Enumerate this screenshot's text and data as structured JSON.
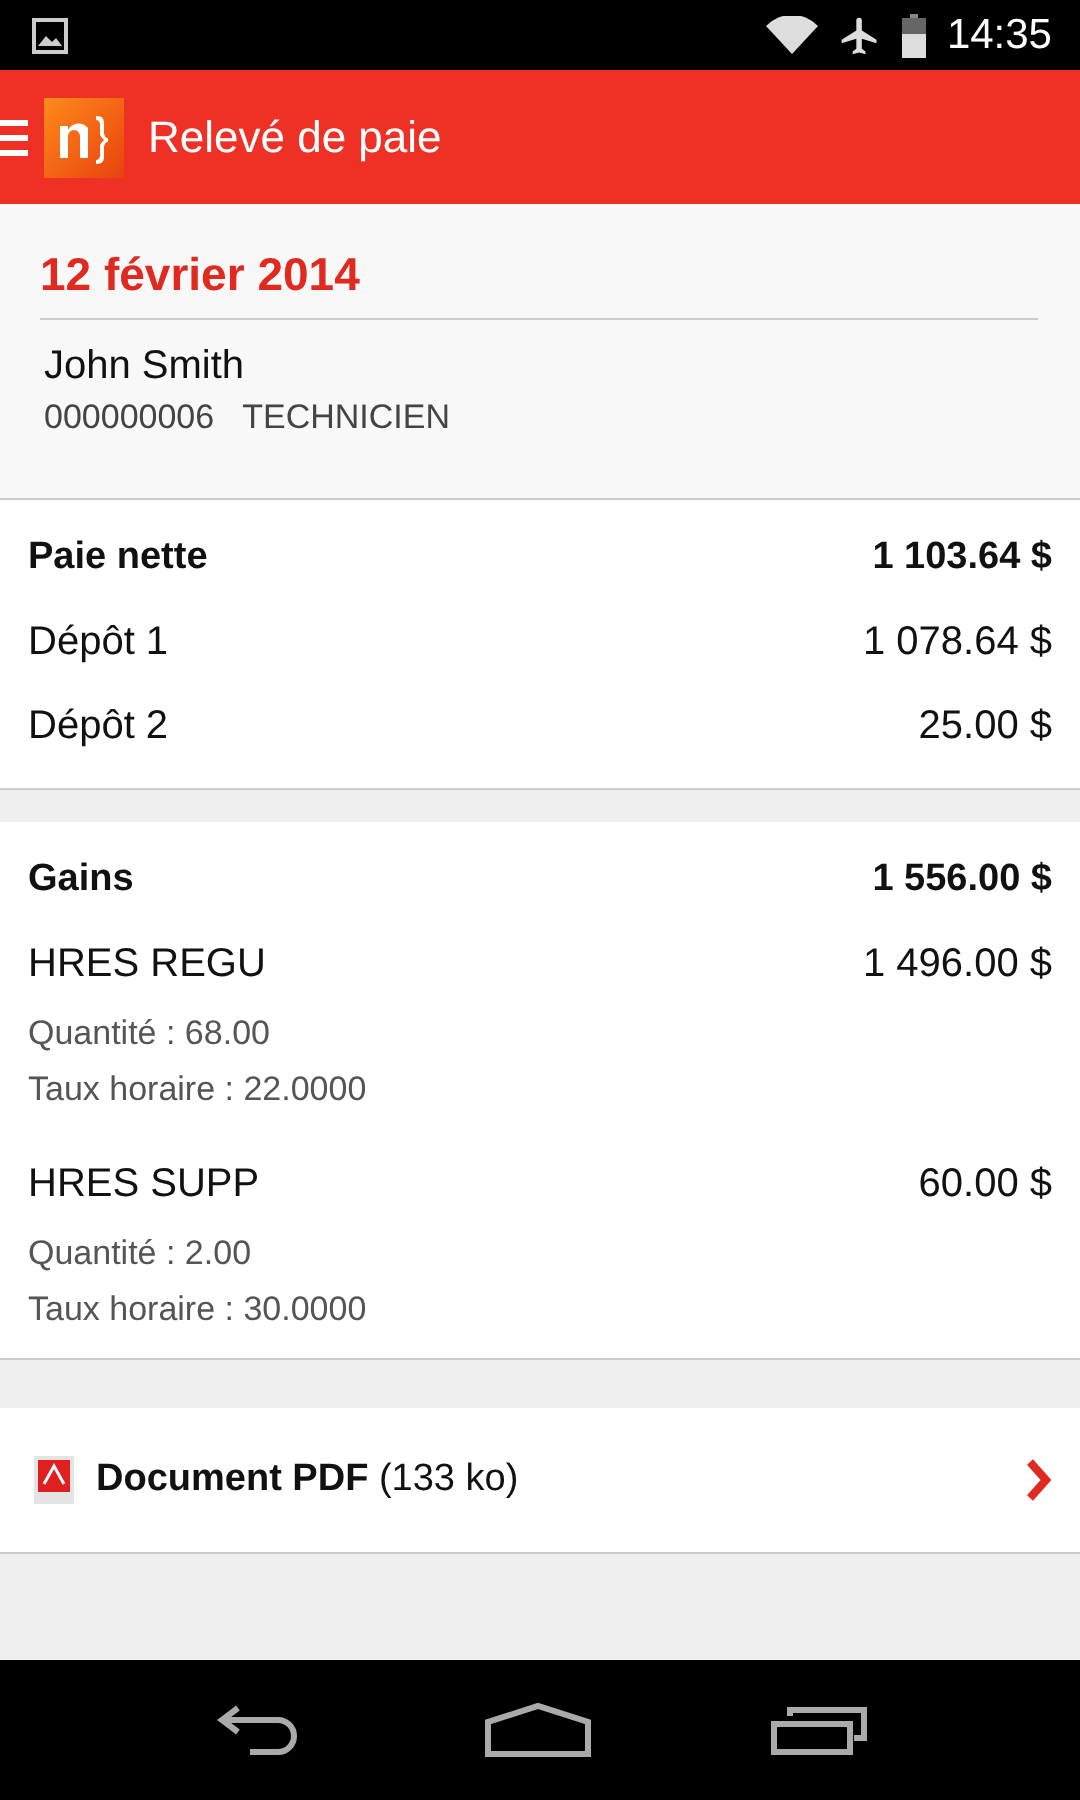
{
  "status_bar": {
    "time": "14:35"
  },
  "app_bar": {
    "title": "Relevé de paie"
  },
  "header": {
    "date": "12 février 2014",
    "name": "John Smith",
    "employee_id": "000000006",
    "job_title": "TECHNICIEN"
  },
  "summary": {
    "label": "Paie nette",
    "amount": "1 103.64 $",
    "rows": [
      {
        "label": "Dépôt 1",
        "amount": "1 078.64 $"
      },
      {
        "label": "Dépôt 2",
        "amount": "25.00 $"
      }
    ]
  },
  "gains": {
    "label": "Gains",
    "amount": "1 556.00 $",
    "items": [
      {
        "label": "HRES REGU",
        "amount": "1 496.00 $",
        "details": [
          "Quantité : 68.00",
          "Taux horaire : 22.0000"
        ]
      },
      {
        "label": "HRES SUPP",
        "amount": "60.00 $",
        "details": [
          "Quantité : 2.00",
          "Taux horaire : 30.0000"
        ]
      }
    ]
  },
  "document": {
    "text": "**Document PDF** (133 ko)"
  }
}
